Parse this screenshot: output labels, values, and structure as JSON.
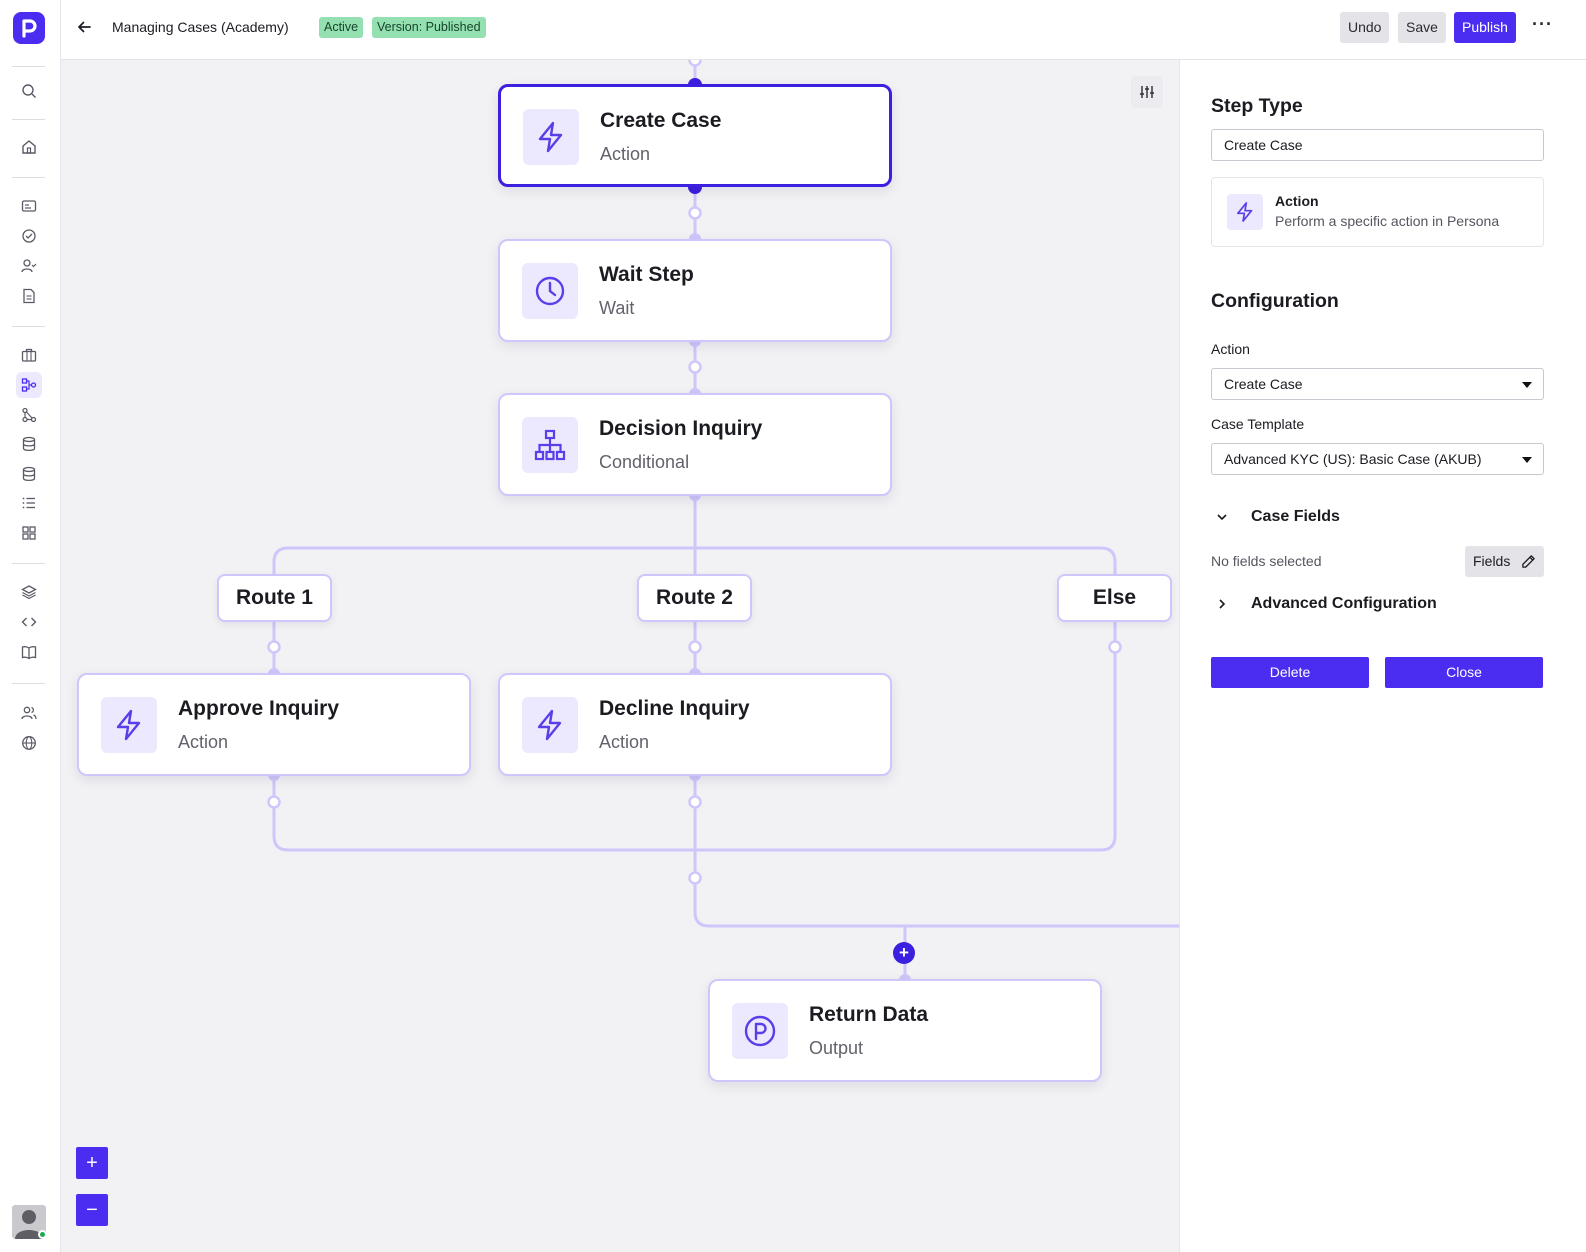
{
  "header": {
    "title": "Managing Cases (Academy)",
    "status_badge": "Active",
    "version_badge": "Version: Published",
    "undo_label": "Undo",
    "save_label": "Save",
    "publish_label": "Publish",
    "more_label": "···"
  },
  "canvas": {
    "nodes": [
      {
        "title": "Create Case",
        "subtitle": "Action",
        "icon": "lightning-icon"
      },
      {
        "title": "Wait Step",
        "subtitle": "Wait",
        "icon": "clock-icon"
      },
      {
        "title": "Decision Inquiry",
        "subtitle": "Conditional",
        "icon": "hierarchy-icon"
      },
      {
        "title": "Approve Inquiry",
        "subtitle": "Action",
        "icon": "lightning-icon"
      },
      {
        "title": "Decline Inquiry",
        "subtitle": "Action",
        "icon": "lightning-icon"
      },
      {
        "title": "Return Data",
        "subtitle": "Output",
        "icon": "persona-logo-icon"
      }
    ],
    "routes": [
      "Route 1",
      "Route 2",
      "Else"
    ],
    "add_label": "+",
    "zoom_in_label": "+",
    "zoom_out_label": "−"
  },
  "panel": {
    "step_type_heading": "Step Type",
    "step_type_value": "Create Case",
    "type_card_title": "Action",
    "type_card_desc": "Perform a specific action in Persona",
    "configuration_heading": "Configuration",
    "action_label": "Action",
    "action_value": "Create Case",
    "case_template_label": "Case Template",
    "case_template_value": "Advanced KYC (US): Basic Case (AKUB)",
    "case_fields_label": "Case Fields",
    "no_fields_text": "No fields selected",
    "fields_button": "Fields",
    "advanced_label": "Advanced Configuration",
    "delete_label": "Delete",
    "close_label": "Close"
  },
  "colors": {
    "brand": "#4a2df0",
    "node_border": "#cfc6fb",
    "badge_green": "#94e0b1"
  }
}
